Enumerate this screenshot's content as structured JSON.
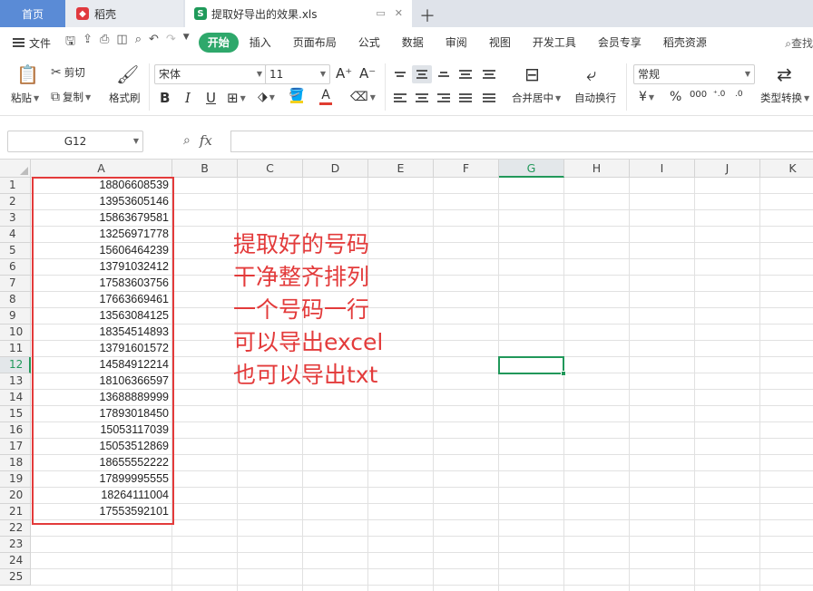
{
  "tabs": {
    "home": "首页",
    "docer": "稻壳",
    "file": "提取好导出的效果.xls"
  },
  "menu": {
    "file": "文件",
    "items": [
      "开始",
      "插入",
      "页面布局",
      "公式",
      "数据",
      "审阅",
      "视图",
      "开发工具",
      "会员专享",
      "稻壳资源"
    ],
    "search": "查找"
  },
  "ribbon": {
    "paste": "粘贴",
    "cut": "剪切",
    "copy": "复制",
    "format_painter": "格式刷",
    "font_name": "宋体",
    "font_size": "11",
    "merge_center": "合并居中",
    "wrap_text": "自动换行",
    "number_format": "常规",
    "type_convert": "类型转换",
    "font_color": "#e03c31",
    "fill_color": "#f5d01e"
  },
  "formula_bar": {
    "name_box": "G12",
    "fx": "fx",
    "formula": ""
  },
  "sheet": {
    "columns": [
      "A",
      "B",
      "C",
      "D",
      "E",
      "F",
      "G",
      "H",
      "I",
      "J",
      "K"
    ],
    "selected_column": "G",
    "selected_row": 12,
    "rows": [
      "1",
      "2",
      "3",
      "4",
      "5",
      "6",
      "7",
      "8",
      "9",
      "10",
      "11",
      "12",
      "13",
      "14",
      "15",
      "16",
      "17",
      "18",
      "19",
      "20",
      "21",
      "22",
      "23",
      "24",
      "25"
    ],
    "column_a": [
      "18806608539",
      "13953605146",
      "15863679581",
      "13256971778",
      "15606464239",
      "13791032412",
      "17583603756",
      "17663669461",
      "13563084125",
      "18354514893",
      "13791601572",
      "14584912214",
      "18106366597",
      "13688889999",
      "17893018450",
      "15053117039",
      "15053512869",
      "18655552222",
      "17899995555",
      "18264111004",
      "17553592101"
    ],
    "annotation": [
      "提取好的号码",
      "干净整齐排列",
      "一个号码一行",
      "可以导出excel",
      "也可以导出txt"
    ],
    "annotation_color": "#e33b3b",
    "accent_color": "#21985a"
  }
}
